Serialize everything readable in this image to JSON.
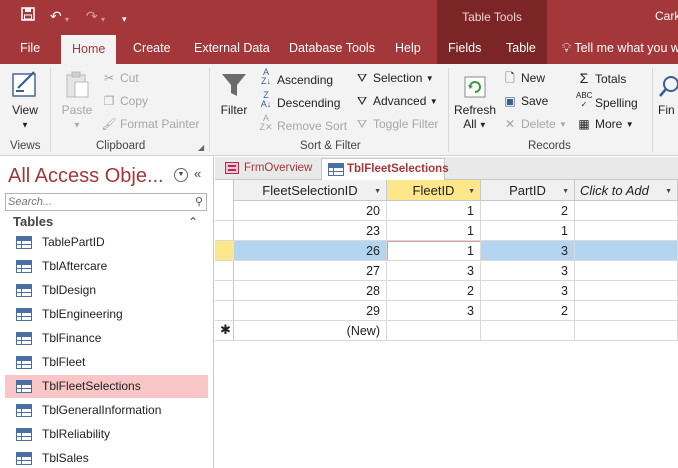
{
  "titlebar": {
    "contextual_group": "Table Tools",
    "user_text": "Cark"
  },
  "ribbon_tabs": [
    "File",
    "Home",
    "Create",
    "External Data",
    "Database Tools",
    "Help",
    "Fields",
    "Table"
  ],
  "active_tab": "Home",
  "tell_me": "Tell me what you w",
  "groups": {
    "views": {
      "label": "Views",
      "view_label": "View"
    },
    "clipboard": {
      "label": "Clipboard",
      "paste": "Paste",
      "cut": "Cut",
      "copy": "Copy",
      "format_painter": "Format Painter"
    },
    "sort_filter": {
      "label": "Sort & Filter",
      "filter": "Filter",
      "ascending": "Ascending",
      "descending": "Descending",
      "remove_sort": "Remove Sort",
      "selection": "Selection",
      "advanced": "Advanced",
      "toggle_filter": "Toggle Filter"
    },
    "records": {
      "label": "Records",
      "refresh": "Refresh",
      "refresh_all": "All",
      "new": "New",
      "save": "Save",
      "delete": "Delete",
      "totals": "Totals",
      "spelling": "Spelling",
      "more": "More"
    },
    "find": {
      "label": "Fin"
    }
  },
  "nav": {
    "title": "All Access Obje...",
    "search_placeholder": "Search...",
    "section": "Tables",
    "items": [
      "TablePartID",
      "TblAftercare",
      "TblDesign",
      "TblEngineering",
      "TblFinance",
      "TblFleet",
      "TblFleetSelections",
      "TblGeneralInformation",
      "TblReliability",
      "TblSales"
    ],
    "selected_index": 6
  },
  "doc_tabs": [
    {
      "label": "FrmOverview",
      "active": false
    },
    {
      "label": "TblFleetSelections",
      "active": true
    }
  ],
  "datasheet": {
    "columns": [
      "FleetSelectionID",
      "FleetID",
      "PartID",
      "Click to Add"
    ],
    "active_column": 1,
    "rows": [
      [
        "20",
        "1",
        "2"
      ],
      [
        "23",
        "1",
        "1"
      ],
      [
        "26",
        "1",
        "3"
      ],
      [
        "27",
        "3",
        "3"
      ],
      [
        "28",
        "2",
        "3"
      ],
      [
        "29",
        "3",
        "2"
      ]
    ],
    "current_row": 2,
    "new_row_label": "(New)",
    "new_row_marker": "✱"
  },
  "colors": {
    "accent": "#a4373a",
    "contextual": "#7b2527",
    "selected_nav": "#f8c6c6",
    "row_highlight": "#b4d5f0",
    "active_header": "#fde78a"
  }
}
